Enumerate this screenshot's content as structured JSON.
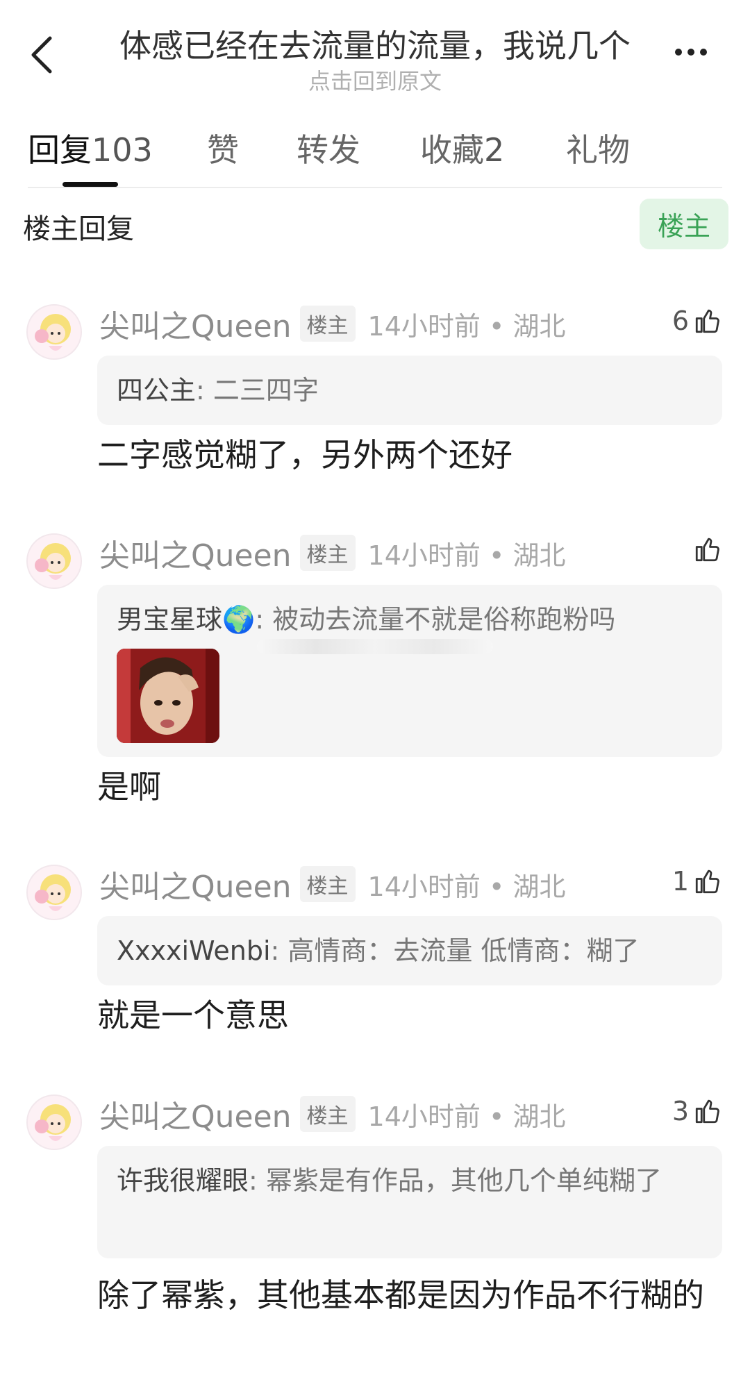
{
  "header": {
    "title": "体感已经在去流量的流量，我说几个",
    "subtitle": "点击回到原文"
  },
  "tabs": [
    {
      "label": "回复",
      "count": "103"
    },
    {
      "label": "赞",
      "count": ""
    },
    {
      "label": "转发",
      "count": ""
    },
    {
      "label": "收藏",
      "count": "2"
    },
    {
      "label": "礼物",
      "count": ""
    }
  ],
  "filter": {
    "label": "楼主回复",
    "op_button": "楼主"
  },
  "comments": [
    {
      "username": "尖叫之Queen",
      "badge": "楼主",
      "time_loc": "14小时前 • 湖北",
      "likes": "6",
      "quote_author": "四公主",
      "quote_text": ": 二三四字",
      "reply": "二字感觉糊了，另外两个还好"
    },
    {
      "username": "尖叫之Queen",
      "badge": "楼主",
      "time_loc": "14小时前 • 湖北",
      "likes": "",
      "quote_author": "男宝星球🌍",
      "quote_text": ": 被动去流量不就是俗称跑粉吗",
      "reply": "是啊"
    },
    {
      "username": "尖叫之Queen",
      "badge": "楼主",
      "time_loc": "14小时前 • 湖北",
      "likes": "1",
      "quote_author": "XxxxiWenbi",
      "quote_text": ": 高情商：去流量 低情商：糊了",
      "reply": "就是一个意思"
    },
    {
      "username": "尖叫之Queen",
      "badge": "楼主",
      "time_loc": "14小时前 • 湖北",
      "likes": "3",
      "quote_author": "许我很耀眼",
      "quote_text": ": 幂紫是有作品，其他几个单纯糊了",
      "reply": "除了幂紫，其他基本都是因为作品不行糊的"
    }
  ]
}
